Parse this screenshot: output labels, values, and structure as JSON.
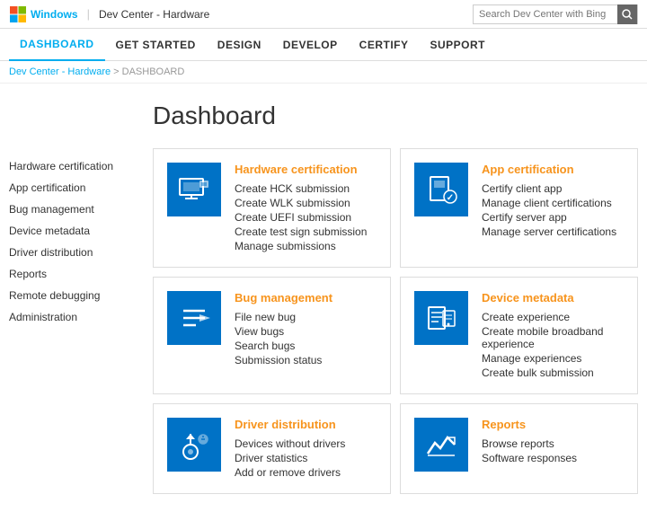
{
  "topbar": {
    "logo_text": "Windows",
    "separator": "|",
    "site_title": "Dev Center - Hardware",
    "search_placeholder": "Search Dev Center with Bing"
  },
  "navbar": {
    "items": [
      {
        "id": "dashboard",
        "label": "DASHBOARD",
        "active": true
      },
      {
        "id": "get-started",
        "label": "GET STARTED",
        "active": false
      },
      {
        "id": "design",
        "label": "DESIGN",
        "active": false
      },
      {
        "id": "develop",
        "label": "DEVELOP",
        "active": false
      },
      {
        "id": "certify",
        "label": "CERTIFY",
        "active": false
      },
      {
        "id": "support",
        "label": "SUPPORT",
        "active": false
      }
    ]
  },
  "breadcrumb": {
    "home": "Dev Center - Hardware",
    "separator": ">",
    "current": "DASHBOARD"
  },
  "page": {
    "title": "Dashboard"
  },
  "sidebar": {
    "links": [
      {
        "id": "hardware-cert",
        "label": "Hardware certification"
      },
      {
        "id": "app-cert",
        "label": "App certification"
      },
      {
        "id": "bug-mgmt",
        "label": "Bug management"
      },
      {
        "id": "device-meta",
        "label": "Device metadata"
      },
      {
        "id": "driver-dist",
        "label": "Driver distribution"
      },
      {
        "id": "reports",
        "label": "Reports"
      },
      {
        "id": "remote-debug",
        "label": "Remote debugging"
      },
      {
        "id": "admin",
        "label": "Administration"
      }
    ]
  },
  "cards": [
    {
      "id": "hardware-cert",
      "title": "Hardware certification",
      "icon": "hardware",
      "links": [
        "Create HCK submission",
        "Create WLK submission",
        "Create UEFI submission",
        "Create test sign submission",
        "Manage submissions"
      ]
    },
    {
      "id": "app-cert",
      "title": "App certification",
      "icon": "app",
      "links": [
        "Certify client app",
        "Manage client certifications",
        "Certify server app",
        "Manage server certifications"
      ]
    },
    {
      "id": "bug-mgmt",
      "title": "Bug management",
      "icon": "bug",
      "links": [
        "File new bug",
        "View bugs",
        "Search bugs",
        "Submission status"
      ]
    },
    {
      "id": "device-meta",
      "title": "Device metadata",
      "icon": "device",
      "links": [
        "Create experience",
        "Create mobile broadband experience",
        "Manage experiences",
        "Create bulk submission"
      ]
    },
    {
      "id": "driver-dist",
      "title": "Driver distribution",
      "icon": "driver",
      "links": [
        "Devices without drivers",
        "Driver statistics",
        "Add or remove drivers"
      ]
    },
    {
      "id": "reports",
      "title": "Reports",
      "icon": "reports",
      "links": [
        "Browse reports",
        "Software responses"
      ]
    }
  ]
}
